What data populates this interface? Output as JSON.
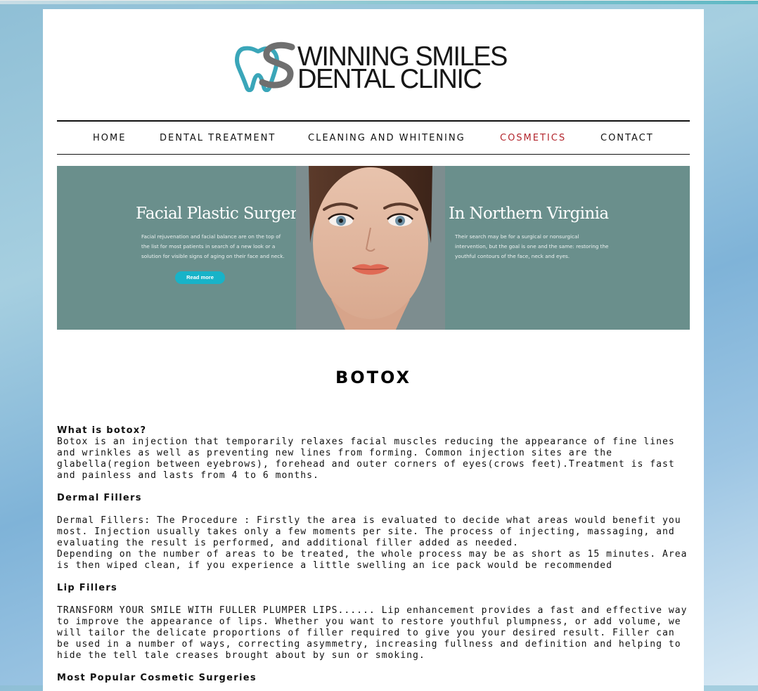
{
  "logo": {
    "line1": "WINNING SMILES",
    "line2": "DENTAL CLINIC",
    "colors": {
      "teal": "#3aa6b9",
      "grey": "#6f6f6f",
      "text": "#161616"
    }
  },
  "nav": {
    "items": [
      {
        "label": "HOME",
        "active": false
      },
      {
        "label": "DENTAL TREATMENT",
        "active": false
      },
      {
        "label": "CLEANING AND WHITENING",
        "active": false
      },
      {
        "label": "COSMETICS",
        "active": true
      },
      {
        "label": "CONTACT",
        "active": false
      }
    ],
    "active_color": "#b3262d"
  },
  "banner": {
    "left_heading": "Facial Plastic Surgery",
    "left_text": "Facial rejuvenation and facial balance are on the top of the list for most patients in search of a new look or a solution for visible signs of aging on their face and neck.",
    "button_label": "Read more",
    "right_heading": "In Northern Virginia",
    "right_text": "Their search may be for a surgical or nonsurgical intervention, but the goal is one and the same: restoring the youthful contours of the face, neck and eyes.",
    "background_color": "#6a8f8c",
    "button_color": "#18b3c8"
  },
  "main": {
    "title": "BOTOX",
    "sections": [
      {
        "heading": "What is botox?",
        "paragraphs": [
          "Botox is an injection that temporarily relaxes facial muscles reducing the appearance of fine lines and wrinkles as well as preventing new lines from forming. Common injection sites are the glabella(region between eyebrows), forehead and outer corners of eyes(crows feet).Treatment is fast and painless and lasts from 4 to 6 months."
        ]
      },
      {
        "heading": "Dermal Fillers",
        "paragraphs": [
          "Dermal Fillers: The Procedure : Firstly the area is evaluated to decide what areas would benefit you most. Injection usually takes only a few moments per site. The process of injecting, massaging, and evaluating the result is performed, and additional filler added as needed.",
          "Depending on the number of areas to be treated, the whole process may be as short as 15 minutes. Area is then wiped clean, if you experience a little swelling an ice pack would be recommended"
        ]
      },
      {
        "heading": "Lip Fillers",
        "paragraphs": [
          "TRANSFORM YOUR SMILE WITH FULLER PLUMPER LIPS...... Lip enhancement provides a fast and effective way to improve the appearance of lips. Whether you want to restore youthful plumpness, or add volume, we will tailor the delicate proportions of filler required to give you your desired result. Filler can be used in a number of ways, correcting asymmetry, increasing fullness and definition and helping to hide the tell tale creases brought about by sun or smoking."
        ]
      },
      {
        "heading": "Most Popular Cosmetic Surgeries",
        "paragraphs": []
      }
    ]
  }
}
